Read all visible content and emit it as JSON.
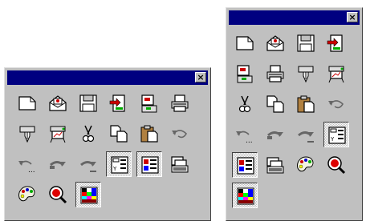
{
  "close_glyph": "×",
  "colors": {
    "face": "#c0c0c0",
    "title": "#000080"
  },
  "left_palette": {
    "icons": [
      "new-document",
      "open-envelope",
      "save-floppy",
      "recolor-page",
      "page-options",
      "print",
      "pen-plotter",
      "plotter",
      "cut-scissors",
      "copy-pages",
      "paste-clipboard",
      "undo-arrow",
      "undo-more",
      "redo-arrow",
      "redo-more",
      "layout-list",
      "layout-columns",
      "page-stack",
      "color-palette",
      "zoom-color",
      "color-chart"
    ],
    "pressed": [
      15,
      16,
      20
    ]
  },
  "right_palette": {
    "icons": [
      "new-document",
      "open-envelope",
      "save-floppy",
      "recolor-page",
      "page-options",
      "print",
      "pen-plotter",
      "plotter",
      "cut-scissors",
      "copy-pages",
      "paste-clipboard",
      "undo-arrow",
      "undo-more",
      "redo-arrow",
      "redo-more",
      "layout-list",
      "layout-columns",
      "page-stack",
      "color-palette",
      "zoom-color",
      "color-chart"
    ],
    "pressed": [
      15,
      16,
      20
    ]
  }
}
